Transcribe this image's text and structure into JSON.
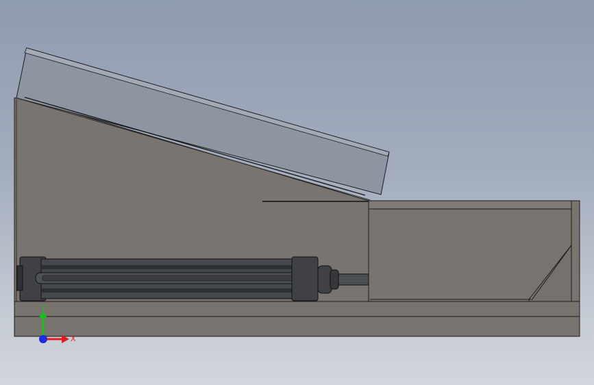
{
  "viewport": {
    "background_top": "#8e9bb0",
    "background_bottom": "#d2d6dc",
    "model": {
      "body_color": "#7a7470",
      "outline_color": "#1a1a1a",
      "cover_color": "#8d95a3",
      "cylinder_color": "#3b3d40"
    }
  },
  "triad": {
    "y_label": "Y",
    "x_label": "X",
    "y_color": "#13c21a",
    "x_color": "#e21c1c",
    "z_color": "#1c2ce0"
  }
}
